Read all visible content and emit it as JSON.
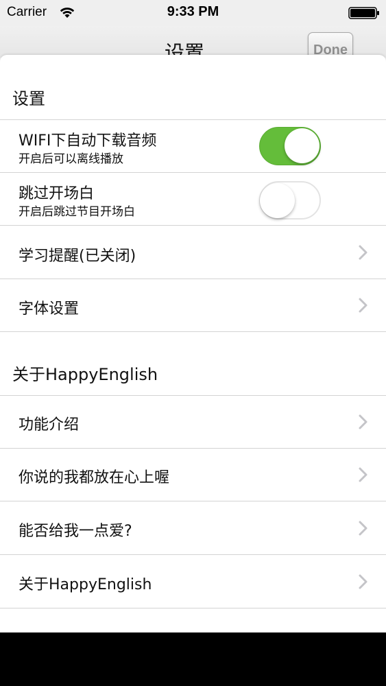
{
  "status_bar": {
    "carrier": "Carrier",
    "time": "9:33 PM",
    "wifi_icon": "wifi-icon",
    "battery_icon": "battery-icon"
  },
  "nav": {
    "title": "设置",
    "done_label": "Done"
  },
  "sections": {
    "settings": {
      "header": "设置",
      "wifi_download": {
        "title": "WIFI下自动下载音频",
        "subtitle": "开启后可以离线播放",
        "enabled": true
      },
      "skip_intro": {
        "title": "跳过开场白",
        "subtitle": "开启后跳过节目开场白",
        "enabled": false
      },
      "study_reminder": {
        "title": "学习提醒(已关闭)"
      },
      "font_settings": {
        "title": "字体设置"
      }
    },
    "about": {
      "header": "关于HappyEnglish",
      "features": {
        "title": "功能介绍"
      },
      "feedback": {
        "title": "你说的我都放在心上喔"
      },
      "rate": {
        "title": "能否给我一点爱?"
      },
      "about_app": {
        "title": "关于HappyEnglish"
      }
    }
  },
  "colors": {
    "toggle_on": "#64bd3a",
    "chevron": "#c4c4c8",
    "separator": "#d3d3d3",
    "done_text": "#8e8e8e"
  }
}
